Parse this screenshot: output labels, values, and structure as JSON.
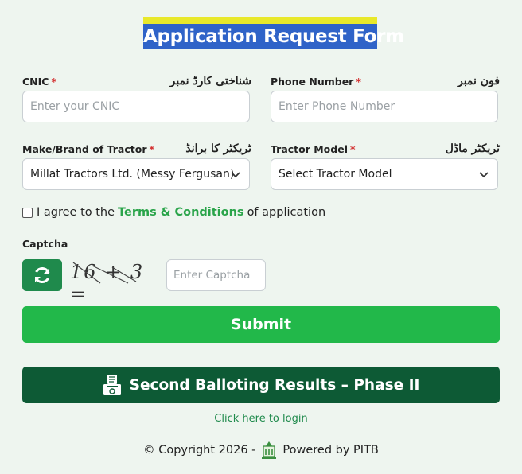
{
  "form": {
    "title": "Application Request Form",
    "fields": {
      "cnic": {
        "label": "CNIC",
        "required_mark": "*",
        "urdu": "شناختی کارڈ نمبر",
        "placeholder": "Enter your CNIC"
      },
      "phone": {
        "label": "Phone Number",
        "required_mark": "*",
        "urdu": "فون نمبر",
        "placeholder": "Enter Phone Number"
      },
      "brand": {
        "label": "Make/Brand of Tractor",
        "required_mark": "*",
        "urdu": "ٹریکٹر کا برانڈ",
        "selected": "Millat Tractors Ltd. (Messy Fergusan)"
      },
      "model": {
        "label": "Tractor Model",
        "required_mark": "*",
        "urdu": "ٹریکٹر ماڈل",
        "selected": "Select Tractor Model"
      }
    },
    "agree": {
      "prefix": "I agree to the",
      "link": "Terms & Conditions",
      "suffix": "of application"
    },
    "captcha": {
      "label": "Captcha",
      "image_text": "16 + 3 =",
      "placeholder": "Enter Captcha"
    },
    "submit_label": "Submit",
    "ballot_label": "Second Balloting Results – Phase II",
    "login_link": "Click here to login"
  },
  "footer": {
    "copyright": "© Copyright 2026 -",
    "powered": "Powered by PITB"
  },
  "colors": {
    "primary": "#22b84a",
    "dark_green": "#0d5a35",
    "title_bg": "#2f63c8",
    "required": "#d32f2f"
  },
  "icons": {
    "refresh": "refresh-icon",
    "chevron": "chevron-down-icon",
    "ballot": "ballot-box-icon",
    "logo": "pitb-logo-icon"
  }
}
